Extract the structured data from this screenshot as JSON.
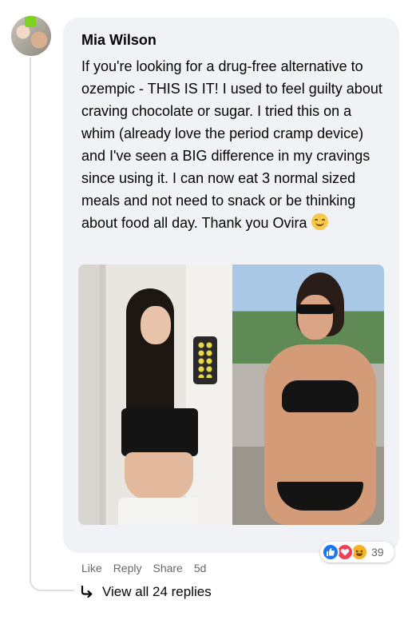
{
  "comment": {
    "author": "Mia Wilson",
    "text": "If you're looking for a drug-free alternative to ozempic - THIS IS IT! I used to feel guilty about craving chocolate or sugar. I tried this on a whim (already love the period cramp device) and I've seen a BIG difference in my cravings since using it. I can now eat 3 normal sized meals and not need to snack or be thinking about food all day. Thank you Ovira",
    "emoji": "smiling-face-emoji"
  },
  "reactions": {
    "icons": [
      "like-icon",
      "love-icon",
      "haha-icon"
    ],
    "count": "39",
    "colors": {
      "like": "#1877f2",
      "love": "#f33e58",
      "haha": "#f7b125"
    }
  },
  "actions": {
    "like": "Like",
    "reply": "Reply",
    "share": "Share",
    "time": "5d"
  },
  "replies": {
    "label": "View all 24 replies"
  },
  "colors": {
    "bubble": "#f0f2f5",
    "secondary_text": "#65676b",
    "thread_line": "#dadde1"
  }
}
